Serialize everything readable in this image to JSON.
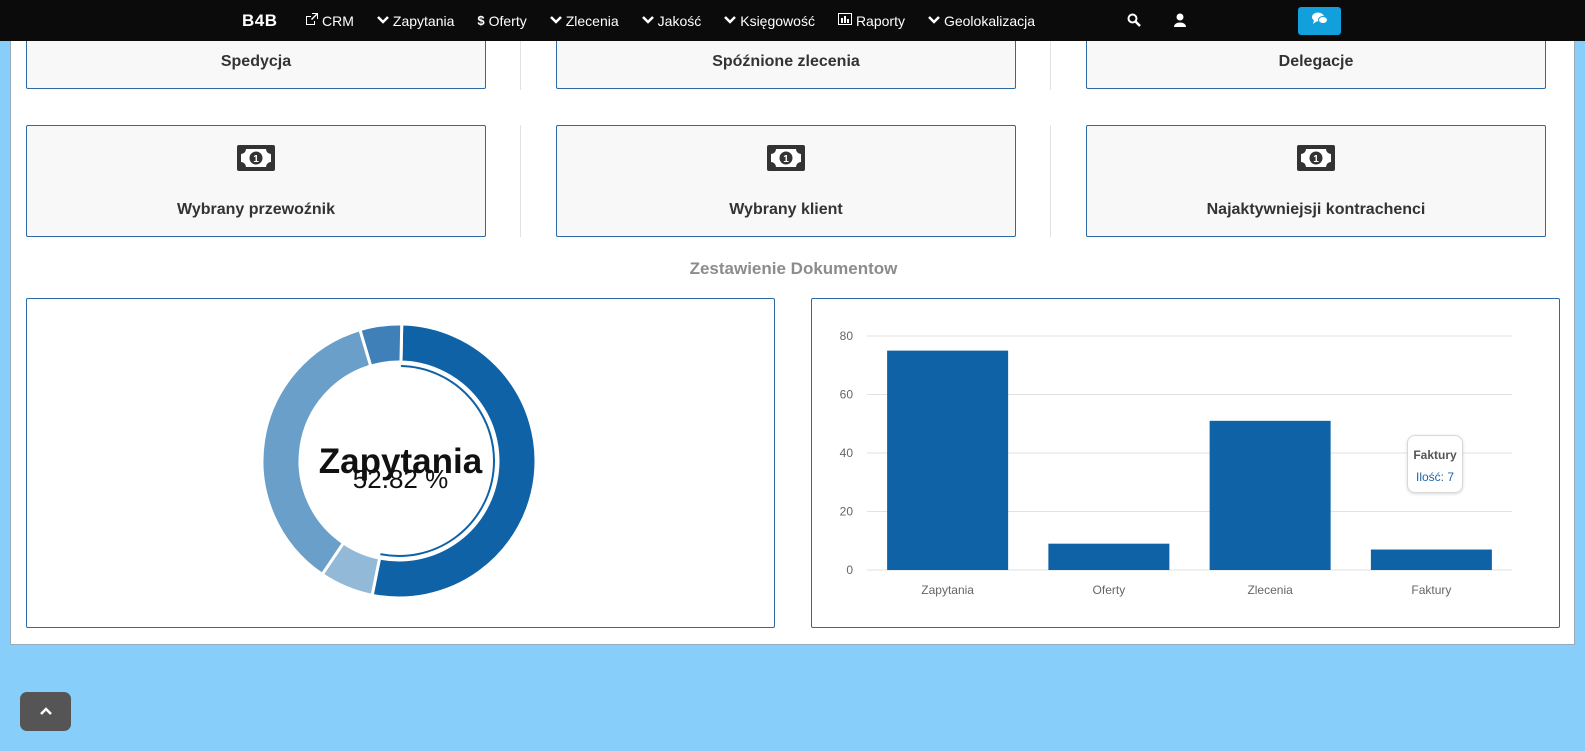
{
  "navbar": {
    "brand": "B4B",
    "items": [
      {
        "label": "CRM",
        "icon": "external-link-icon"
      },
      {
        "label": "Zapytania",
        "icon": "chevron-down-icon"
      },
      {
        "label": "Oferty",
        "icon": "dollar-icon"
      },
      {
        "label": "Zlecenia",
        "icon": "chevron-down-icon"
      },
      {
        "label": "Jakość",
        "icon": "chevron-down-icon"
      },
      {
        "label": "Księgowość",
        "icon": "chevron-down-icon"
      },
      {
        "label": "Raporty",
        "icon": "bar-chart-icon"
      },
      {
        "label": "Geolokalizacja",
        "icon": "chevron-down-icon"
      }
    ],
    "search_icon": "search-icon",
    "user_icon": "user-icon",
    "chat_icon": "comments-icon"
  },
  "tiles_row1": [
    "Spedycja",
    "Spóźnione zlecenia",
    "Delegacje"
  ],
  "tiles_row2": [
    "Wybrany przewoźnik",
    "Wybrany klient",
    "Najaktywniejsji kontrachenci"
  ],
  "section_title": "Zestawienie Dokumentow",
  "donut": {
    "center_title": "Zapytania",
    "center_value": "52.82 %"
  },
  "tooltip": {
    "title": "Faktury",
    "value": "Ilość: 7"
  },
  "colors": {
    "navbar": "#0b0b0b",
    "accent": "#11a0dc",
    "bar": "#0f62a6",
    "page_bg": "#87cefa",
    "donut": [
      "#0f62a6",
      "#93b9d9",
      "#6a9fc9",
      "#3f80b9"
    ]
  },
  "chart_data": [
    {
      "type": "pie",
      "variant": "doughnut",
      "categories": [
        "Zapytania",
        "Oferty",
        "Zlecenia",
        "Faktury"
      ],
      "values": [
        52.82,
        6.34,
        35.92,
        4.92
      ],
      "unit": "%",
      "highlighted": "Zapytania"
    },
    {
      "type": "bar",
      "categories": [
        "Zapytania",
        "Oferty",
        "Zlecenia",
        "Faktury"
      ],
      "values": [
        75,
        9,
        51,
        7
      ],
      "yticks": [
        0,
        20,
        40,
        60,
        80
      ],
      "ylim": [
        0,
        80
      ],
      "grid": true
    }
  ],
  "scroll_top_icon": "chevron-up-icon"
}
